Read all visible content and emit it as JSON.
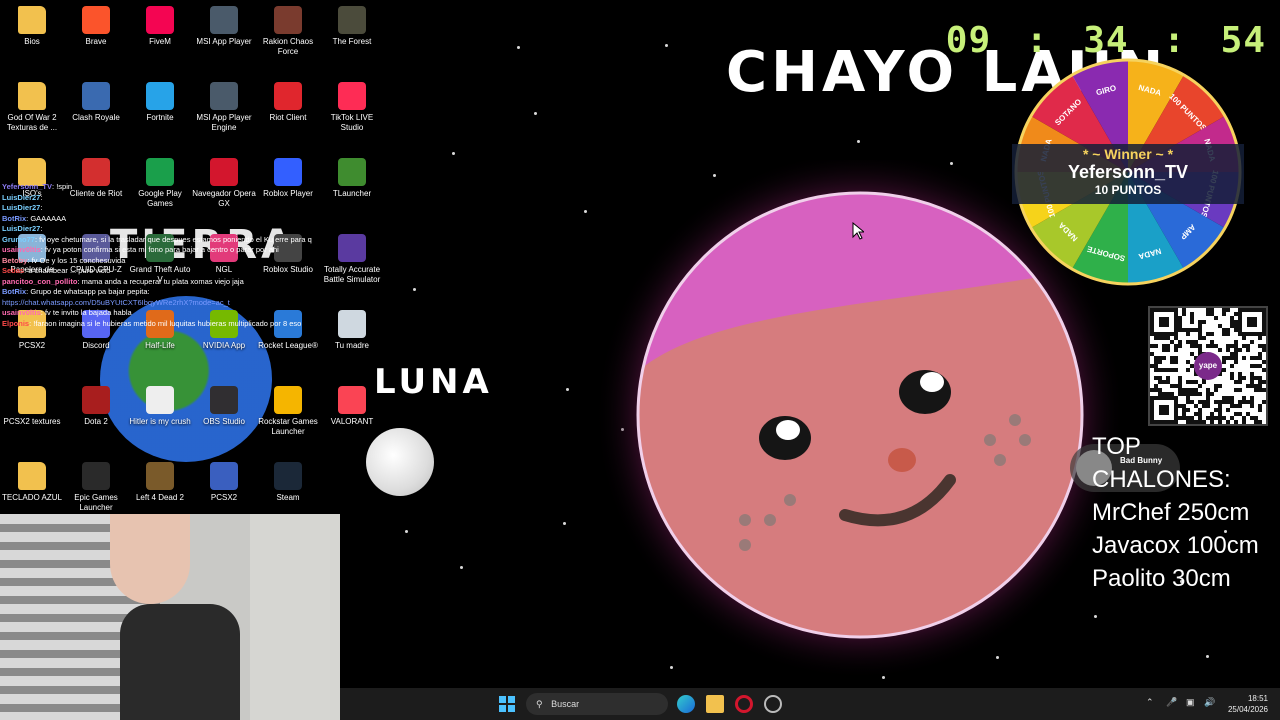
{
  "desktop": {
    "icons": [
      {
        "label": "Bios",
        "icon": "folder-icon",
        "color": "#f2c14e"
      },
      {
        "label": "Brave",
        "icon": "brave-icon",
        "color": "#fb542b"
      },
      {
        "label": "FiveM",
        "icon": "fivem-icon",
        "color": "#f40552"
      },
      {
        "label": "MSI App Player",
        "icon": "msi-app-player-icon",
        "color": "#4a5a6a"
      },
      {
        "label": "Rakion Chaos Force",
        "icon": "rakion-icon",
        "color": "#7a3b2e"
      },
      {
        "label": "The Forest",
        "icon": "the-forest-icon",
        "color": "#4b4b3b"
      },
      {
        "label": "God Of War 2 Texturas de ...",
        "icon": "folder-icon",
        "color": "#f2c14e"
      },
      {
        "label": "Clash Royale",
        "icon": "clash-royale-icon",
        "color": "#3a6ab0"
      },
      {
        "label": "Fortnite",
        "icon": "fortnite-icon",
        "color": "#27a3e8"
      },
      {
        "label": "MSI App Player Engine",
        "icon": "msi-engine-icon",
        "color": "#4a5a6a"
      },
      {
        "label": "Riot Client",
        "icon": "riot-client-icon",
        "color": "#e0262d"
      },
      {
        "label": "TikTok LIVE Studio",
        "icon": "tiktok-icon",
        "color": "#fe2c55"
      },
      {
        "label": "ISO's",
        "icon": "folder-icon",
        "color": "#f2c14e"
      },
      {
        "label": "Cliente de Riot",
        "icon": "riot-icon",
        "color": "#d32f2f"
      },
      {
        "label": "Google Play Games",
        "icon": "google-play-games-icon",
        "color": "#1a9f4b"
      },
      {
        "label": "Navegador Opera GX",
        "icon": "opera-gx-icon",
        "color": "#d3162d"
      },
      {
        "label": "Roblox Player",
        "icon": "roblox-icon",
        "color": "#335fff"
      },
      {
        "label": "TLauncher",
        "icon": "tlauncher-icon",
        "color": "#3f8c2f"
      },
      {
        "label": "Papelera de",
        "icon": "recycle-bin-icon",
        "color": "#8ab4d8"
      },
      {
        "label": "CPUID CPU-Z",
        "icon": "cpu-z-icon",
        "color": "#5a5a9a"
      },
      {
        "label": "Grand Theft Auto V",
        "icon": "gta-v-icon",
        "color": "#2a6a3a"
      },
      {
        "label": "NGL",
        "icon": "ngl-icon",
        "color": "#e23a7a"
      },
      {
        "label": "Roblox Studio",
        "icon": "roblox-studio-icon",
        "color": "#444"
      },
      {
        "label": "Totally Accurate Battle Simulator",
        "icon": "tabs-icon",
        "color": "#5a3aa0"
      },
      {
        "label": "PCSX2",
        "icon": "folder-icon",
        "color": "#f2c14e"
      },
      {
        "label": "Discord",
        "icon": "discord-icon",
        "color": "#5865f2"
      },
      {
        "label": "Half-Life",
        "icon": "half-life-icon",
        "color": "#e06a1a"
      },
      {
        "label": "NVIDIA App",
        "icon": "nvidia-icon",
        "color": "#76b900"
      },
      {
        "label": "Rocket League®",
        "icon": "rocket-league-icon",
        "color": "#2a7ad8"
      },
      {
        "label": "Tu madre",
        "icon": "tu-madre-icon",
        "color": "#cfd8e0"
      },
      {
        "label": "PCSX2 textures",
        "icon": "folder-icon",
        "color": "#f2c14e"
      },
      {
        "label": "Dota 2",
        "icon": "dota2-icon",
        "color": "#a81e1e"
      },
      {
        "label": "Hitler is my crush",
        "icon": "image-file-icon",
        "color": "#eeeeee"
      },
      {
        "label": "OBS Studio",
        "icon": "obs-icon",
        "color": "#302e31"
      },
      {
        "label": "Rockstar Games Launcher",
        "icon": "rockstar-icon",
        "color": "#f5b500"
      },
      {
        "label": "VALORANT",
        "icon": "valorant-icon",
        "color": "#fa4454"
      },
      {
        "label": "TECLADO AZUL",
        "icon": "folder-icon",
        "color": "#f2c14e"
      },
      {
        "label": "Epic Games Launcher",
        "icon": "epic-games-icon",
        "color": "#2a2a2a"
      },
      {
        "label": "Left 4 Dead 2",
        "icon": "left4dead-icon",
        "color": "#7a5a2a"
      },
      {
        "label": "PCSX2",
        "icon": "pcsx2-icon",
        "color": "#3a5fbf"
      },
      {
        "label": "Steam",
        "icon": "steam-icon",
        "color": "#1b2838"
      }
    ]
  },
  "chat": [
    {
      "user": "Yefersonn_TV",
      "msg": ": !spin",
      "color": "#8a7af0"
    },
    {
      "user": "LuisDier27",
      "msg": ": ",
      "color": "#7ad0ff"
    },
    {
      "user": "LuisDier27",
      "msg": ": ",
      "color": "#7ad0ff"
    },
    {
      "user": "BotRix",
      "msg": ": GAAAAAA",
      "color": "#7a9aff"
    },
    {
      "user": "LuisDier27",
      "msg": ": ",
      "color": "#7ad0ff"
    },
    {
      "user": "Grumo77",
      "msg": ": fv oye chetumare, si la trasladar que despues estamos poniendo el Ku erre para que te mandemos centimos",
      "color": "#7ad0ff"
    },
    {
      "user": "usainv0ltis",
      "msg": ": fv ya poton confirma si esta mi fono para bajar a centro o parar por ahi",
      "color": "#ff6ab0"
    },
    {
      "user": "Betoby",
      "msg": ": fv Oe y los 15 conchesuvida",
      "color": "#ff8aa0"
    },
    {
      "user": "Sebas",
      "msg": ": a chambear ... puro vicio",
      "color": "#ff4a4a"
    },
    {
      "user": "pancitoo_con_pollito",
      "msg": ": mama anda a recuperar tu plata xomas viejo jaja",
      "color": "#ff6ab0"
    },
    {
      "user": "BotRix",
      "msg": ": Grupo de whatsapp pa bajar pepita:",
      "color": "#7a9aff"
    },
    {
      "user": "",
      "msg": "https://chat.whatsapp.com/D5uBYUtCXT6IbqyWRe2rhX?mode=ac_t",
      "color": "#7a9aff"
    },
    {
      "user": "usainv0ltis",
      "msg": ": fv te invito la bajada habla",
      "color": "#ff6ab0"
    },
    {
      "user": "Elponis",
      "msg": ": !faraon imagina si le hubieras metido mil luquitas hubieras multiplicado por 8 eso",
      "color": "#ff4a4a"
    }
  ],
  "drawing": {
    "title_text": "CHAYO LAUN",
    "tierra_text": "TIERRA",
    "luna_text": "LUNA"
  },
  "clock": {
    "hours": "09",
    "minutes": "34",
    "seconds": "54",
    "sep": ":"
  },
  "wheel": {
    "segments": [
      "NADA",
      "100 PUNTOS",
      "NADA",
      "100 PUNTOS",
      "AMP",
      "NADA",
      "SOPORTE",
      "NADA",
      "100 PUNTOS",
      "NADA",
      "SOTANO",
      "GIRO"
    ],
    "winner_title": "* ~ Winner ~ *",
    "winner_name": "Yefersonn_TV",
    "winner_prize": "10 PUNTOS"
  },
  "qr": {
    "brand": "yape"
  },
  "top": {
    "title": "TOP CHALONES:",
    "rows": [
      "MrChef 250cm",
      "Javacox 100cm",
      "Paolito 30cm"
    ],
    "badge": "Bad Bunny"
  },
  "taskbar": {
    "search_placeholder": "Buscar",
    "time": "18:51",
    "date": "25/04/2026"
  }
}
